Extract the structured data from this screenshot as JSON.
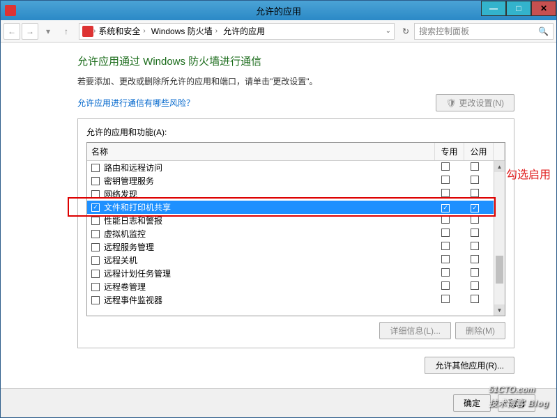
{
  "titlebar": {
    "title": "允许的应用"
  },
  "winbtns": {
    "min": "—",
    "max": "□",
    "close": "✕"
  },
  "nav": {
    "back": "←",
    "fwd": "→",
    "dropdown": "▾",
    "up": "↑",
    "refresh": "↻",
    "bcdrop": "⌄"
  },
  "breadcrumb": {
    "segs": [
      "系统和安全",
      "Windows 防火墙",
      "允许的应用"
    ],
    "sep": "›"
  },
  "search": {
    "placeholder": "搜索控制面板",
    "icon": "🔍"
  },
  "page": {
    "heading": "允许应用通过 Windows 防火墙进行通信",
    "subtext": "若要添加、更改或删除所允许的应用和端口，请单击\"更改设置\"。",
    "risk_link": "允许应用进行通信有哪些风险？",
    "change_btn": "更改设置(N)",
    "change_icon": "🛡"
  },
  "panel": {
    "label": "允许的应用和功能(A):",
    "cols": {
      "name": "名称",
      "private": "专用",
      "public": "公用"
    },
    "rows": [
      {
        "name": "路由和远程访问",
        "checked": false,
        "priv": false,
        "pub": false
      },
      {
        "name": "密钥管理服务",
        "checked": false,
        "priv": false,
        "pub": false
      },
      {
        "name": "网络发现",
        "checked": false,
        "priv": false,
        "pub": false
      },
      {
        "name": "文件和打印机共享",
        "checked": true,
        "priv": true,
        "pub": true,
        "selected": true
      },
      {
        "name": "性能日志和警报",
        "checked": false,
        "priv": false,
        "pub": false
      },
      {
        "name": "虚拟机监控",
        "checked": false,
        "priv": false,
        "pub": false
      },
      {
        "name": "远程服务管理",
        "checked": false,
        "priv": false,
        "pub": false
      },
      {
        "name": "远程关机",
        "checked": false,
        "priv": false,
        "pub": false
      },
      {
        "name": "远程计划任务管理",
        "checked": false,
        "priv": false,
        "pub": false
      },
      {
        "name": "远程卷管理",
        "checked": false,
        "priv": false,
        "pub": false
      },
      {
        "name": "远程事件监视器",
        "checked": false,
        "priv": false,
        "pub": false
      }
    ],
    "details_btn": "详细信息(L)...",
    "remove_btn": "删除(M)",
    "allow_other_btn": "允许其他应用(R)..."
  },
  "dialog": {
    "ok": "确定",
    "cancel": "取消"
  },
  "annotation": "勾选启用",
  "watermark": {
    "main": "51CTO.com",
    "sub": "技术博客   Blog"
  },
  "glyphs": {
    "check": "✓",
    "up": "▲",
    "down": "▼"
  }
}
